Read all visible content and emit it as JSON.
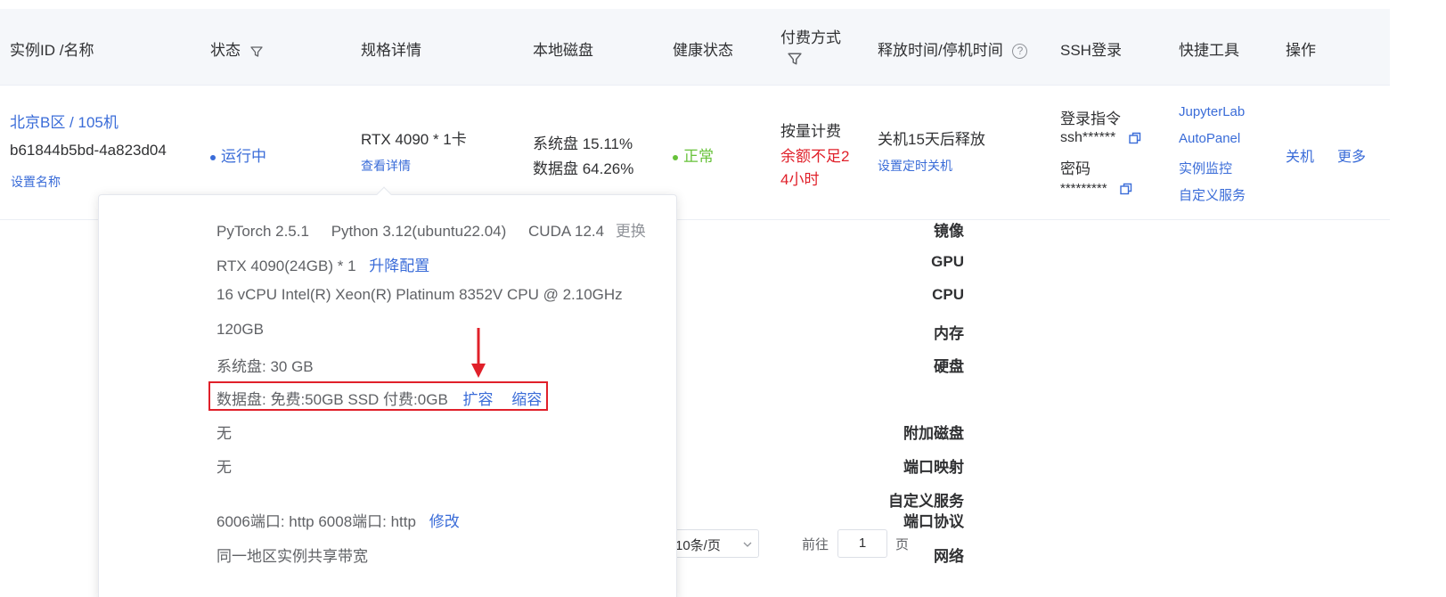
{
  "header": {
    "instance_col": "实例ID /名称",
    "status_col": "状态",
    "spec_col": "规格详情",
    "disk_col": "本地磁盘",
    "health_col": "健康状态",
    "billing_col_line1": "付费方式",
    "release_col": "释放时间/停机时间",
    "ssh_col": "SSH登录",
    "tools_col": "快捷工具",
    "action_col": "操作"
  },
  "row": {
    "name": "北京B区 / 105机",
    "id": "b61844b5bd-4a823d04",
    "set_name": "设置名称",
    "status": "运行中",
    "spec": "RTX 4090 * 1卡",
    "view_detail": "查看详情",
    "sys_disk": "系统盘 15.11%",
    "data_disk": "数据盘 64.26%",
    "health": "正常",
    "billing": "按量计费",
    "billing_warn_line1": "余额不足2",
    "billing_warn_line2": "4小时",
    "release": "关机15天后释放",
    "set_shutdown": "设置定时关机",
    "ssh_cmd_label": "登录指令",
    "ssh_cmd": "ssh******",
    "password_label": "密码",
    "password": "*********",
    "tools": [
      "JupyterLab",
      "AutoPanel",
      "实例监控",
      "自定义服务"
    ],
    "action_shutdown": "关机",
    "action_more": "更多"
  },
  "popover": {
    "image_label": "镜像",
    "image_pytorch": "PyTorch  2.5.1",
    "image_python": "Python  3.12(ubuntu22.04)",
    "image_cuda": "CUDA  12.4",
    "image_change": "更换",
    "gpu_label": "GPU",
    "gpu_value": "RTX 4090(24GB) * 1",
    "gpu_upgrade": "升降配置",
    "cpu_label": "CPU",
    "cpu_value": "16 vCPU Intel(R) Xeon(R) Platinum 8352V CPU @ 2.10GHz",
    "mem_label": "内存",
    "mem_value": "120GB",
    "disk_label": "硬盘",
    "disk_sys": "系统盘:  30 GB",
    "disk_data": "数据盘:  免费:50GB SSD  付费:0GB",
    "disk_expand": "扩容",
    "disk_shrink": "缩容",
    "extra_disk_label": "附加磁盘",
    "extra_disk_value": "无",
    "port_map_label": "端口映射",
    "port_map_value": "无",
    "custom_svc_label_line1": "自定义服务",
    "custom_svc_label_line2": "端口协议",
    "custom_svc_value": "6006端口:  http    6008端口:  http",
    "custom_svc_edit": "修改",
    "network_label": "网络",
    "network_value": "同一地区实例共享带宽"
  },
  "pagination": {
    "page_size": "10条/页",
    "goto_label": "前往",
    "page_input": "1",
    "page_suffix": "页"
  },
  "colors": {
    "link": "#3a6cd8",
    "health_green": "#67c23a",
    "warn_red": "#e0202a",
    "highlight_red": "#e0202a"
  }
}
